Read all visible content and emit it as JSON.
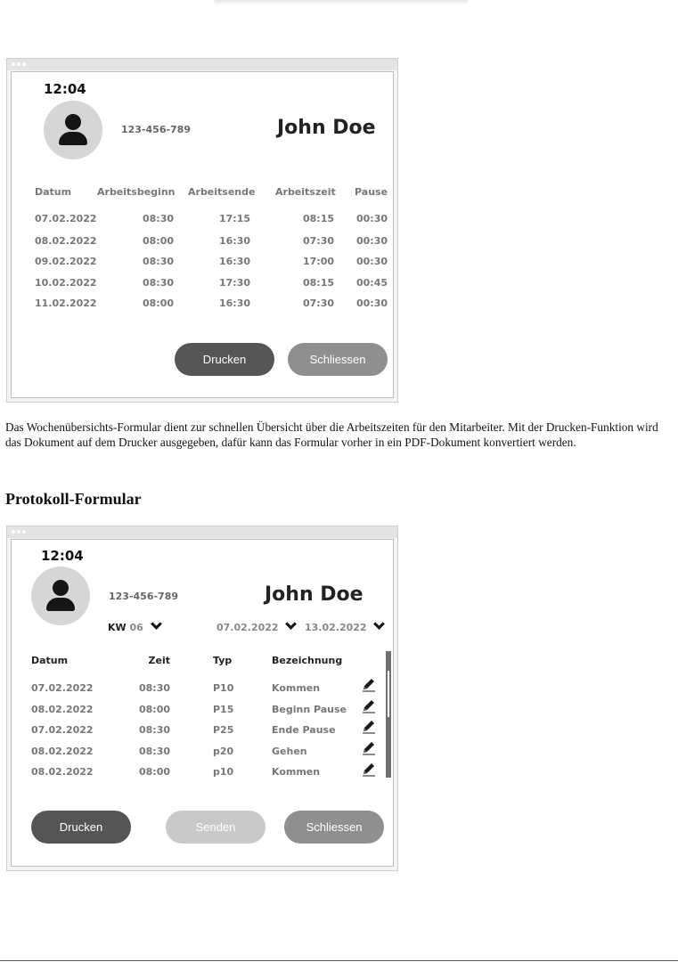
{
  "weekly": {
    "time": "12:04",
    "phone": "123-456-789",
    "name": "John Doe",
    "headers": [
      "Datum",
      "Arbeitsbeginn",
      "Arbeitsende",
      "Arbeitszeit",
      "Pause"
    ],
    "rows": [
      [
        "07.02.2022",
        "08:30",
        "17:15",
        "08:15",
        "00:30"
      ],
      [
        "08.02.2022",
        "08:00",
        "16:30",
        "07:30",
        "00:30"
      ],
      [
        "09.02.2022",
        "08:30",
        "16:30",
        "17:00",
        "00:30"
      ],
      [
        "10.02.2022",
        "08:30",
        "17:30",
        "08:15",
        "00:45"
      ],
      [
        "11.02.2022",
        "08:00",
        "16:30",
        "07:30",
        "00:30"
      ]
    ],
    "print_label": "Drucken",
    "close_label": "Schliessen"
  },
  "description": "Das Wochenübersichts-Formular dient zur schnellen Übersicht über die Arbeitszeiten für den Mitarbeiter. Mit der Drucken-Funktion wird das Dokument auf dem Drucker ausgegeben, dafür kann das Formular vorher in ein PDF-Dokument konvertiert werden.",
  "section_heading": "Protokoll-Formular",
  "protocol": {
    "time": "12:04",
    "phone": "123-456-789",
    "name": "John Doe",
    "kw_label": "KW",
    "kw_value": "06",
    "date_from": "07.02.2022",
    "date_to": "13.02.2022",
    "headers": [
      "Datum",
      "Zeit",
      "Typ",
      "Bezeichnung"
    ],
    "rows": [
      [
        "07.02.2022",
        "08:30",
        "P10",
        "Kommen"
      ],
      [
        "08.02.2022",
        "08:00",
        "P15",
        "Beginn Pause"
      ],
      [
        "07.02.2022",
        "08:30",
        "P25",
        "Ende Pause"
      ],
      [
        "08.02.2022",
        "08:30",
        "p20",
        "Gehen"
      ],
      [
        "08.02.2022",
        "08:00",
        "p10",
        "Kommen"
      ]
    ],
    "print_label": "Drucken",
    "send_label": "Senden",
    "close_label": "Schliessen"
  },
  "icons": {
    "avatar": "user-icon",
    "dropdown": "chevron-down-icon",
    "edit": "pencil-icon"
  }
}
